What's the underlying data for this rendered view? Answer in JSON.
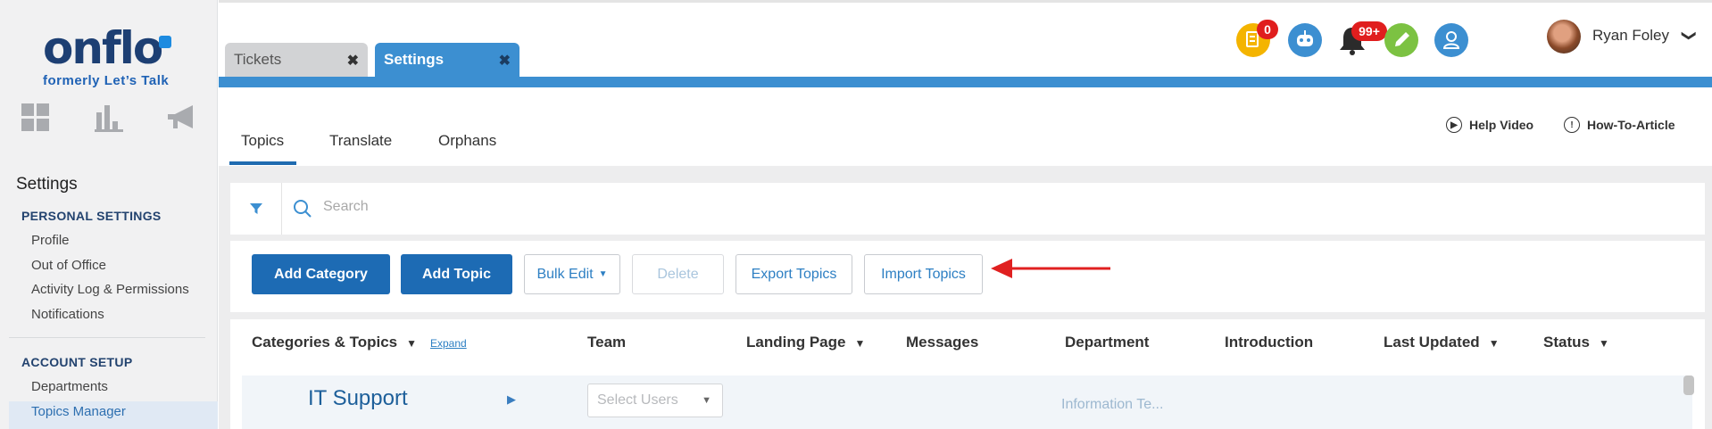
{
  "brand": {
    "logo": "onflo",
    "tagline": "formerly Let’s Talk"
  },
  "sidebar": {
    "title": "Settings",
    "sections": [
      {
        "heading": "PERSONAL SETTINGS",
        "items": [
          "Profile",
          "Out of Office",
          "Activity Log & Permissions",
          "Notifications"
        ]
      },
      {
        "heading": "ACCOUNT SETUP",
        "items": [
          "Departments",
          "Topics Manager"
        ]
      }
    ],
    "active_item": "Topics Manager"
  },
  "tabs": [
    {
      "label": "Tickets",
      "close": "✖"
    },
    {
      "label": "Settings",
      "close": "✖"
    }
  ],
  "header": {
    "badges": {
      "tasks_count": "0",
      "notifications_count": "99+"
    },
    "user_name": "Ryan Foley",
    "user_caret": "❯"
  },
  "subtabs": [
    "Topics",
    "Translate",
    "Orphans"
  ],
  "help": {
    "video": "Help Video",
    "article": "How-To-Article"
  },
  "search": {
    "placeholder": "Search"
  },
  "actions": {
    "add_category": "Add Category",
    "add_topic": "Add Topic",
    "bulk_edit": "Bulk Edit",
    "delete": "Delete",
    "export": "Export Topics",
    "import": "Import Topics"
  },
  "table": {
    "headers": {
      "categories": "Categories & Topics",
      "expand": "Expand",
      "team": "Team",
      "landing": "Landing Page",
      "messages": "Messages",
      "department": "Department",
      "introduction": "Introduction",
      "updated": "Last Updated",
      "status": "Status"
    },
    "rows": [
      {
        "title": "IT Support",
        "team_placeholder": "Select Users",
        "department": "Information Te..."
      }
    ]
  },
  "colors": {
    "primary": "#1d6bb4",
    "tab_active": "#3c8fd1",
    "badge": "#e01e1e",
    "annotation_arrow": "#e02020"
  }
}
